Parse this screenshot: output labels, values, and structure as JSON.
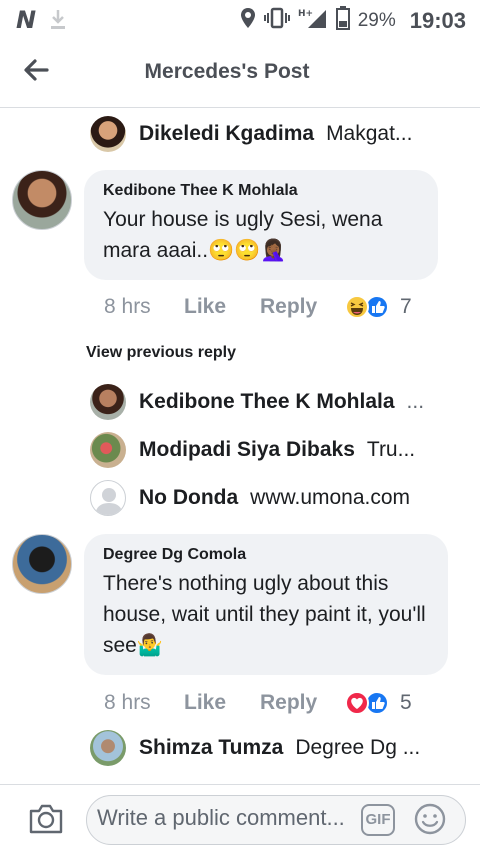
{
  "status_bar": {
    "carrier_logo": "N",
    "network_label": "H+",
    "battery_percent": "29%",
    "time": "19:03"
  },
  "app_bar": {
    "title": "Mercedes's Post"
  },
  "comments": [
    {
      "kind": "reply-preview",
      "name": "Dikeledi Kgadima",
      "text": "Makgat..."
    },
    {
      "kind": "comment",
      "name": "Kedibone Thee K Mohlala",
      "text": "Your house is ugly Sesi, wena mara aaai..🙄🙄🤦🏾‍♀️",
      "time": "8 hrs",
      "like": "Like",
      "reply": "Reply",
      "reaction_count": "7"
    },
    {
      "kind": "view-previous",
      "text": "View previous reply"
    },
    {
      "kind": "reply-preview",
      "name": "Kedibone Thee K Mohlala",
      "text": "..."
    },
    {
      "kind": "reply-preview",
      "name": "Modipadi Siya Dibaks",
      "text": "Tru..."
    },
    {
      "kind": "reply-preview",
      "name": "No Donda",
      "text": "www.umona.com"
    },
    {
      "kind": "comment",
      "name": "Degree Dg Comola",
      "text": "There's nothing ugly about this house, wait until they paint it, you'll see🤷‍♂️",
      "time": "8 hrs",
      "like": "Like",
      "reply": "Reply",
      "reaction_count": "5"
    },
    {
      "kind": "reply-preview",
      "name": "Shimza Tumza",
      "text": "Degree Dg ..."
    }
  ],
  "composer": {
    "placeholder": "Write a public comment...",
    "gif_label": "GIF"
  },
  "colors": {
    "accent_blue": "#1877f2",
    "bubble_grey": "#f0f2f5",
    "meta_grey": "#8d949e"
  }
}
